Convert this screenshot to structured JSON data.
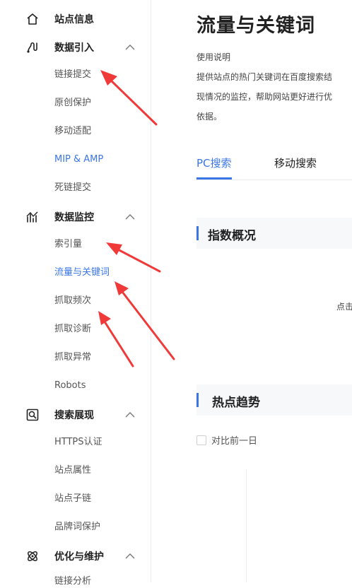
{
  "sidebar": {
    "groups": [
      {
        "label": "站点信息",
        "icon": "home-icon"
      },
      {
        "label": "数据引入",
        "icon": "data-import-icon",
        "items": [
          "链接提交",
          "原创保护",
          "移动适配",
          "MIP & AMP",
          "死链提交"
        ]
      },
      {
        "label": "数据监控",
        "icon": "monitor-icon",
        "items": [
          "索引量",
          "流量与关键词",
          "抓取频次",
          "抓取诊断",
          "抓取异常",
          "Robots"
        ]
      },
      {
        "label": "搜索展现",
        "icon": "search-display-icon",
        "items": [
          "HTTPS认证",
          "站点属性",
          "站点子链",
          "品牌词保护"
        ]
      },
      {
        "label": "优化与维护",
        "icon": "optimize-icon",
        "items": [
          "链接分析"
        ]
      }
    ],
    "active_item": "流量与关键词"
  },
  "main": {
    "title": "流量与关键词",
    "usage": {
      "heading": "使用说明",
      "lines": [
        "提供站点的热门关键词在百度搜索结",
        "现情况的监控，帮助网站更好进行优",
        "依据。"
      ]
    },
    "tabs": [
      {
        "label": "PC搜索",
        "active": true
      },
      {
        "label": "移动搜索",
        "active": false
      }
    ],
    "sections": {
      "index_overview": "指数概况",
      "hot_trend": "热点趋势"
    },
    "click_hint": "点击",
    "compare_label": "对比前一日"
  },
  "colors": {
    "accent": "#3a76e6",
    "annotation_arrow": "#f03a3a",
    "band_bg": "#f7f8fa"
  }
}
